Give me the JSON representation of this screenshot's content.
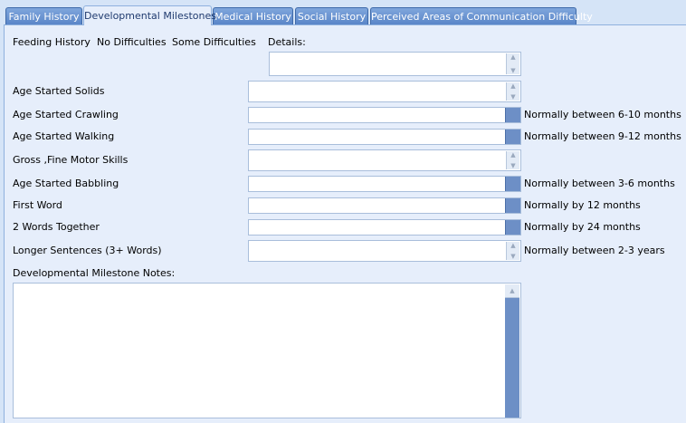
{
  "tabs": [
    {
      "label": "Family History"
    },
    {
      "label": "Developmental Milestones"
    },
    {
      "label": "Medical History"
    },
    {
      "label": "Social History"
    },
    {
      "label": "Perceived Areas of Communication Difficulty"
    }
  ],
  "feeding": {
    "label": "Feeding History",
    "no_difficulties": "No Difficulties",
    "some_difficulties": "Some Difficulties",
    "details_label": "Details:",
    "details_value": ""
  },
  "rows": [
    {
      "label": "Age Started Solids",
      "value": "",
      "hint": ""
    },
    {
      "label": "Age Started Crawling",
      "value": "",
      "hint": "Normally between 6-10 months"
    },
    {
      "label": "Age Started Walking",
      "value": "",
      "hint": "Normally between 9-12 months"
    },
    {
      "label": "Gross ,Fine Motor Skills",
      "value": "",
      "hint": ""
    },
    {
      "label": "Age Started Babbling",
      "value": "",
      "hint": "Normally between 3-6 months"
    },
    {
      "label": "First Word",
      "value": "",
      "hint": "Normally by 12 months"
    },
    {
      "label": "2 Words Together",
      "value": "",
      "hint": "Normally by 24 months"
    },
    {
      "label": "Longer Sentences (3+ Words)",
      "value": "",
      "hint": "Normally between 2-3 years"
    }
  ],
  "notes": {
    "label": "Developmental Milestone Notes:",
    "value": ""
  },
  "icons": {
    "spin_up": "up-arrow-icon",
    "spin_down": "down-arrow-icon"
  }
}
